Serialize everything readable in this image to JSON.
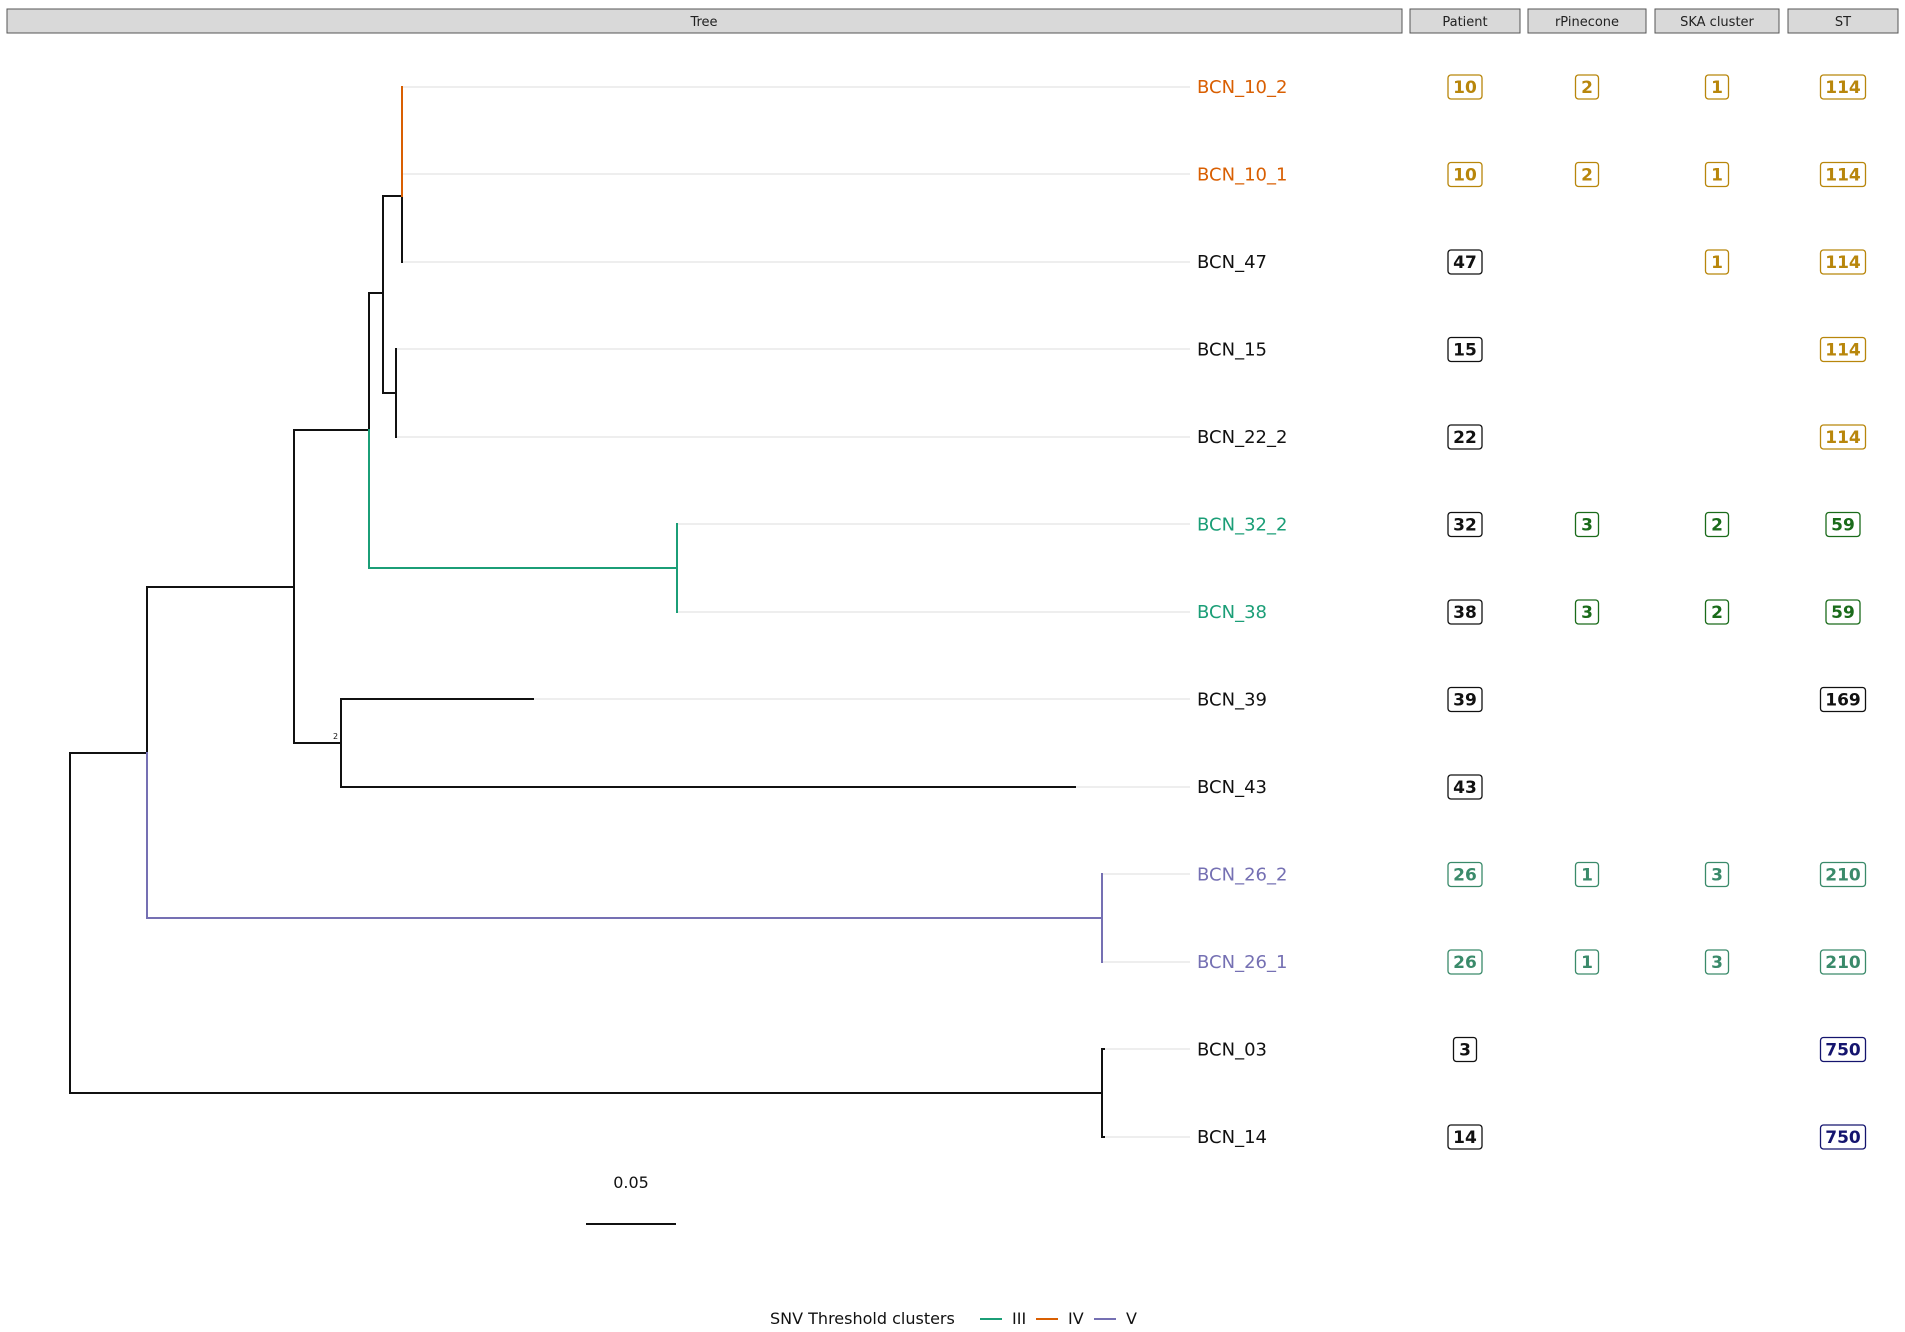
{
  "headers": {
    "tree": "Tree",
    "patient": "Patient",
    "rpinecone": "rPinecone",
    "ska": "SKA cluster",
    "st": "ST"
  },
  "colors": {
    "cluster_III": "#1b9e77",
    "cluster_IV": "#d95f02",
    "cluster_V": "#7570b3",
    "st_114": "#b8860b",
    "st_59": "#1a6b1a",
    "st_210": "#3a8a6a",
    "st_750": "#14146e",
    "default": "#111111",
    "header_fill": "#d9d9d9"
  },
  "tips": [
    {
      "label": "BCN_10_2",
      "cluster": "IV",
      "patient": "10",
      "rpinecone": "2",
      "ska": "1",
      "st": "114",
      "group": "st_114"
    },
    {
      "label": "BCN_10_1",
      "cluster": "IV",
      "patient": "10",
      "rpinecone": "2",
      "ska": "1",
      "st": "114",
      "group": "st_114"
    },
    {
      "label": "BCN_47",
      "cluster": "",
      "patient": "47",
      "rpinecone": "",
      "ska": "1",
      "st": "114",
      "group": "st_114"
    },
    {
      "label": "BCN_15",
      "cluster": "",
      "patient": "15",
      "rpinecone": "",
      "ska": "",
      "st": "114",
      "group": "st_114"
    },
    {
      "label": "BCN_22_2",
      "cluster": "",
      "patient": "22",
      "rpinecone": "",
      "ska": "",
      "st": "114",
      "group": "st_114"
    },
    {
      "label": "BCN_32_2",
      "cluster": "III",
      "patient": "32",
      "rpinecone": "3",
      "ska": "2",
      "st": "59",
      "group": "st_59"
    },
    {
      "label": "BCN_38",
      "cluster": "III",
      "patient": "38",
      "rpinecone": "3",
      "ska": "2",
      "st": "59",
      "group": "st_59"
    },
    {
      "label": "BCN_39",
      "cluster": "",
      "patient": "39",
      "rpinecone": "",
      "ska": "",
      "st": "169",
      "group": "default"
    },
    {
      "label": "BCN_43",
      "cluster": "",
      "patient": "43",
      "rpinecone": "",
      "ska": "",
      "st": "",
      "group": "default"
    },
    {
      "label": "BCN_26_2",
      "cluster": "V",
      "patient": "26",
      "rpinecone": "1",
      "ska": "3",
      "st": "210",
      "group": "st_210"
    },
    {
      "label": "BCN_26_1",
      "cluster": "V",
      "patient": "26",
      "rpinecone": "1",
      "ska": "3",
      "st": "210",
      "group": "st_210"
    },
    {
      "label": "BCN_03",
      "cluster": "",
      "patient": "3",
      "rpinecone": "",
      "ska": "",
      "st": "750",
      "group": "st_750"
    },
    {
      "label": "BCN_14",
      "cluster": "",
      "patient": "14",
      "rpinecone": "",
      "ska": "",
      "st": "750",
      "group": "st_750"
    }
  ],
  "node_label": "2",
  "scale_bar": {
    "label": "0.05"
  },
  "legend": {
    "title": "SNV Threshold clusters",
    "items": [
      {
        "label": "III",
        "color": "#1b9e77"
      },
      {
        "label": "IV",
        "color": "#d95f02"
      },
      {
        "label": "V",
        "color": "#7570b3"
      }
    ]
  }
}
